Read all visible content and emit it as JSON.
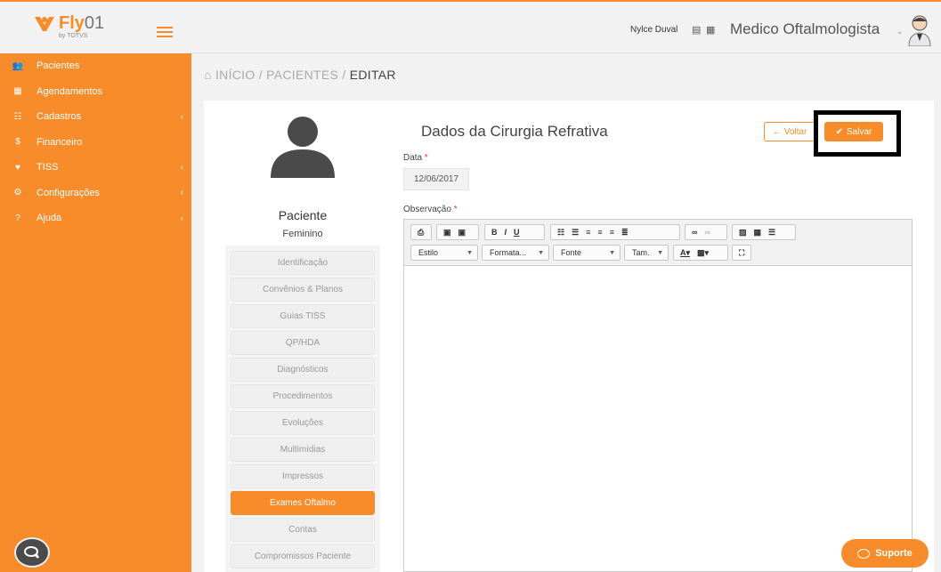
{
  "brand": {
    "logo_text": "Fly",
    "logo_zero": "01",
    "logo_sub": "by TOTVS"
  },
  "sidebar": {
    "items": [
      {
        "label": "Pacientes",
        "icon": "users-icon",
        "has_chevron": false
      },
      {
        "label": "Agendamentos",
        "icon": "calendar-icon",
        "has_chevron": false
      },
      {
        "label": "Cadastros",
        "icon": "list-icon",
        "has_chevron": true
      },
      {
        "label": "Financeiro",
        "icon": "dollar-icon",
        "has_chevron": false
      },
      {
        "label": "TISS",
        "icon": "heartbeat-icon",
        "has_chevron": true
      },
      {
        "label": "Configurações",
        "icon": "gear-icon",
        "has_chevron": true
      },
      {
        "label": "Ajuda",
        "icon": "question-icon",
        "has_chevron": true
      }
    ]
  },
  "topbar": {
    "user": "Nylce Duval",
    "role": "Medico Oftalmologista"
  },
  "breadcrumb": {
    "home": "INÍCIO",
    "sep1": " / ",
    "section": "PACIENTES",
    "sep2": " / ",
    "current": "EDITAR"
  },
  "patient": {
    "title": "Paciente",
    "gender": "Feminino"
  },
  "patient_menu": [
    "Identificação",
    "Convênios & Planos",
    "Guias TISS",
    "QP/HDA",
    "Diagnósticos",
    "Procedimentos",
    "Evoluções",
    "Multimídias",
    "Impressos",
    "Exames Oftalmo",
    "Contas",
    "Compromissos Paciente"
  ],
  "patient_menu_active": "Exames Oftalmo",
  "form": {
    "title": "Dados da Cirurgia Refrativa",
    "voltar_label": "Voltar",
    "salvar_label": "Salvar",
    "data_label": "Data",
    "data_value": "12/06/2017",
    "obs_label": "Observação",
    "required_mark": "*"
  },
  "editor": {
    "combo_estilo": "Estilo",
    "combo_formata": "Formata...",
    "combo_fonte": "Fonte",
    "combo_tam": "Tam."
  },
  "support": {
    "label": "Suporte"
  },
  "colors": {
    "accent": "#f98c2a",
    "accent_dark": "#f47b14",
    "required": "#e33333"
  }
}
